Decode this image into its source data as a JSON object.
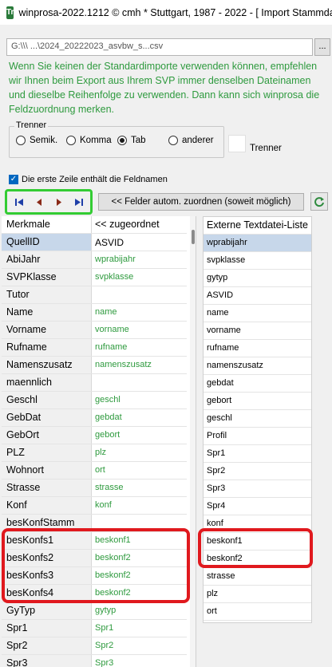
{
  "window": {
    "title": "winprosa-2022.1212 © cmh * Stuttgart, 1987 - 2022 - [ Import Stammdat",
    "icon_label": "Tr"
  },
  "file": {
    "path": "G:\\\\\\ ...\\2024_20222023_asvbw_s...csv",
    "browse_label": "..."
  },
  "info_text": "Wenn Sie keinen der Standardimporte verwenden können, empfehlen wir Ihnen beim Export aus Ihrem SVP immer denselben Dateinamen und dieselbe Reihenfolge zu verwenden. Dann kann sich winprosa die Feldzuordnung merken.",
  "separator": {
    "legend": "Trenner",
    "options": [
      "Semik.",
      "Komma",
      "Tab",
      "anderer"
    ],
    "selected": "Tab",
    "side_label": "Trenner"
  },
  "header_checkbox": {
    "label": "Die erste Zeile enthält die Feldnamen",
    "checked": true
  },
  "nav": {
    "first": "first-record",
    "prev": "previous-record",
    "next": "next-record",
    "last": "last-record"
  },
  "auto_assign_label": "<< Felder autom. zuordnen (soweit möglich)",
  "left_grid": {
    "header": {
      "name": "Merkmale",
      "value": "<< zugeordnet"
    },
    "rows": [
      {
        "name": "QuellID",
        "value": "ASVID"
      },
      {
        "name": "AbiJahr",
        "value": "wprabijahr"
      },
      {
        "name": "SVPKlasse",
        "value": "svpklasse"
      },
      {
        "name": "Tutor",
        "value": ""
      },
      {
        "name": "Name",
        "value": "name"
      },
      {
        "name": "Vorname",
        "value": "vorname"
      },
      {
        "name": "Rufname",
        "value": "rufname"
      },
      {
        "name": "Namenszusatz",
        "value": "namenszusatz"
      },
      {
        "name": "maennlich",
        "value": ""
      },
      {
        "name": "Geschl",
        "value": "geschl"
      },
      {
        "name": "GebDat",
        "value": "gebdat"
      },
      {
        "name": "GebOrt",
        "value": "gebort"
      },
      {
        "name": "PLZ",
        "value": "plz"
      },
      {
        "name": "Wohnort",
        "value": "ort"
      },
      {
        "name": "Strasse",
        "value": "strasse"
      },
      {
        "name": "Konf",
        "value": "konf"
      },
      {
        "name": "besKonfStamm",
        "value": ""
      },
      {
        "name": "besKonfs1",
        "value": "beskonf1"
      },
      {
        "name": "besKonfs2",
        "value": "beskonf2"
      },
      {
        "name": "besKonfs3",
        "value": "beskonf2"
      },
      {
        "name": "besKonfs4",
        "value": "beskonf2"
      },
      {
        "name": "GyTyp",
        "value": "gytyp"
      },
      {
        "name": "Spr1",
        "value": "Spr1"
      },
      {
        "name": "Spr2",
        "value": "Spr2"
      },
      {
        "name": "Spr3",
        "value": "Spr3"
      }
    ]
  },
  "right_grid": {
    "header": "Externe Textdatei-Liste",
    "rows": [
      "wprabijahr",
      "svpklasse",
      "gytyp",
      "ASVID",
      "name",
      "vorname",
      "rufname",
      "namenszusatz",
      "gebdat",
      "gebort",
      "geschl",
      "Profil",
      "Spr1",
      "Spr2",
      "Spr3",
      "Spr4",
      "konf",
      "beskonf1",
      "beskonf2",
      "strasse",
      "plz",
      "ort"
    ]
  },
  "colors": {
    "accent_green": "#2e9a3e",
    "highlight_red": "#e0191e",
    "nav_highlight": "#33cc33",
    "selection": "#c7d7ea"
  }
}
